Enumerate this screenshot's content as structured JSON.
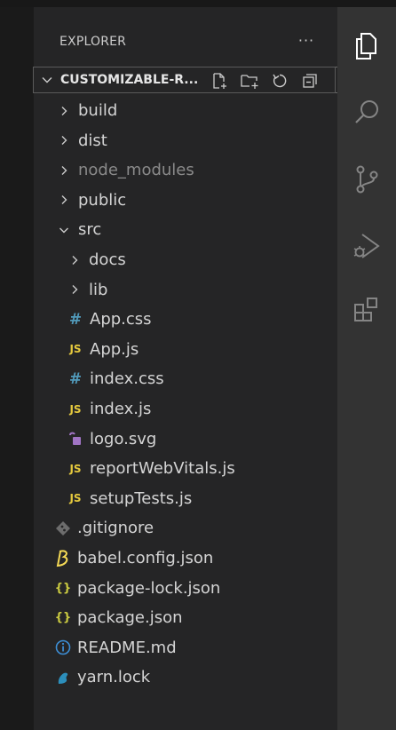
{
  "sidebar": {
    "header_title": "EXPLORER",
    "more_label": "···",
    "section_title": "CUSTOMIZABLE-R...",
    "section_actions": [
      "new-file-icon",
      "new-folder-icon",
      "refresh-icon",
      "collapse-all-icon"
    ]
  },
  "tree": [
    {
      "name": "tree-folder-build",
      "label": "build",
      "type": "folder",
      "expanded": false,
      "depth": 0,
      "dim": false
    },
    {
      "name": "tree-folder-dist",
      "label": "dist",
      "type": "folder",
      "expanded": false,
      "depth": 0,
      "dim": false
    },
    {
      "name": "tree-folder-node-modules",
      "label": "node_modules",
      "type": "folder",
      "expanded": false,
      "depth": 0,
      "dim": true
    },
    {
      "name": "tree-folder-public",
      "label": "public",
      "type": "folder",
      "expanded": false,
      "depth": 0,
      "dim": false
    },
    {
      "name": "tree-folder-src",
      "label": "src",
      "type": "folder",
      "expanded": true,
      "depth": 0,
      "dim": false
    },
    {
      "name": "tree-folder-docs",
      "label": "docs",
      "type": "folder",
      "expanded": false,
      "depth": 1,
      "dim": false
    },
    {
      "name": "tree-folder-lib",
      "label": "lib",
      "type": "folder",
      "expanded": false,
      "depth": 1,
      "dim": false
    },
    {
      "name": "tree-file-app-css",
      "label": "App.css",
      "type": "file",
      "icon": "css-hash-icon",
      "depth": 1
    },
    {
      "name": "tree-file-app-js",
      "label": "App.js",
      "type": "file",
      "icon": "js-icon",
      "depth": 1
    },
    {
      "name": "tree-file-index-css",
      "label": "index.css",
      "type": "file",
      "icon": "css-hash-icon",
      "depth": 1
    },
    {
      "name": "tree-file-index-js",
      "label": "index.js",
      "type": "file",
      "icon": "js-icon",
      "depth": 1
    },
    {
      "name": "tree-file-logo-svg",
      "label": "logo.svg",
      "type": "file",
      "icon": "svg-icon",
      "depth": 1
    },
    {
      "name": "tree-file-report-web-vitals",
      "label": "reportWebVitals.js",
      "type": "file",
      "icon": "js-icon",
      "depth": 1
    },
    {
      "name": "tree-file-setup-tests",
      "label": "setupTests.js",
      "type": "file",
      "icon": "js-icon",
      "depth": 1
    },
    {
      "name": "tree-file-gitignore",
      "label": ".gitignore",
      "type": "file",
      "icon": "git-diamond-icon",
      "depth": 0
    },
    {
      "name": "tree-file-babel-config",
      "label": "babel.config.json",
      "type": "file",
      "icon": "babel-icon",
      "depth": 0
    },
    {
      "name": "tree-file-package-lock",
      "label": "package-lock.json",
      "type": "file",
      "icon": "json-braces-icon",
      "depth": 0
    },
    {
      "name": "tree-file-package-json",
      "label": "package.json",
      "type": "file",
      "icon": "json-braces-icon",
      "depth": 0
    },
    {
      "name": "tree-file-readme",
      "label": "README.md",
      "type": "file",
      "icon": "info-icon",
      "depth": 0
    },
    {
      "name": "tree-file-yarn-lock",
      "label": "yarn.lock",
      "type": "file",
      "icon": "yarn-icon",
      "depth": 0
    }
  ],
  "activity_bar": [
    "explorer-icon",
    "search-icon",
    "source-control-icon",
    "run-debug-icon",
    "extensions-icon"
  ],
  "colors": {
    "js": "#e5c93e",
    "css": "#519aba",
    "json": "#cbcb41",
    "svg": "#a074c4",
    "info": "#3d8fd6",
    "git": "#6d6d6d"
  }
}
